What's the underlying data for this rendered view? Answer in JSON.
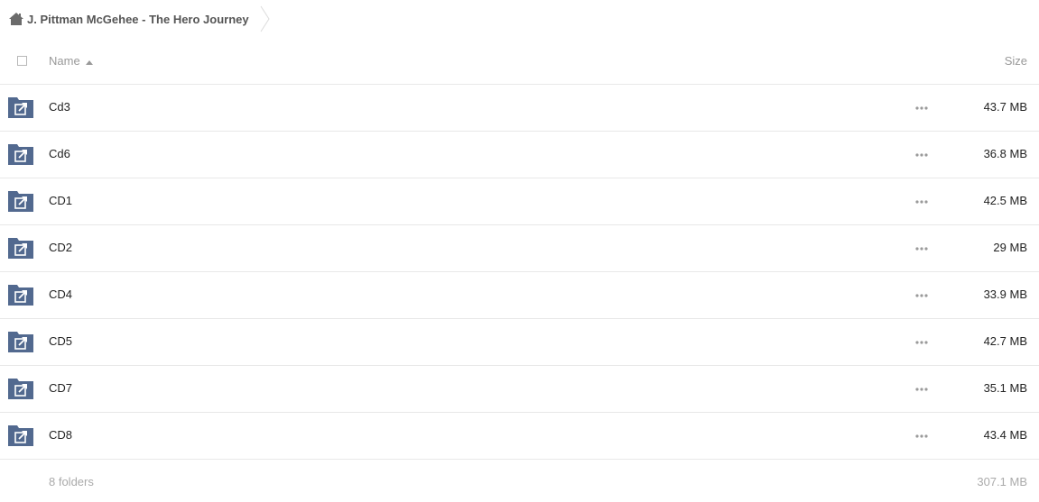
{
  "breadcrumb": {
    "home_icon": "home-icon",
    "title": "J. Pittman McGehee - The Hero Journey"
  },
  "table": {
    "name_header": "Name",
    "size_header": "Size",
    "sort": "ascending",
    "rows": [
      {
        "name": "Cd3",
        "size": "43.7 MB"
      },
      {
        "name": "Cd6",
        "size": "36.8 MB"
      },
      {
        "name": "CD1",
        "size": "42.5 MB"
      },
      {
        "name": "CD2",
        "size": "29 MB"
      },
      {
        "name": "CD4",
        "size": "33.9 MB"
      },
      {
        "name": "CD5",
        "size": "42.7 MB"
      },
      {
        "name": "CD7",
        "size": "35.1 MB"
      },
      {
        "name": "CD8",
        "size": "43.4 MB"
      }
    ]
  },
  "footer": {
    "count": "8 folders",
    "total": "307.1 MB"
  },
  "colors": {
    "folder": "#52698f",
    "divider": "#e8e8e8",
    "muted_text": "#999999"
  }
}
